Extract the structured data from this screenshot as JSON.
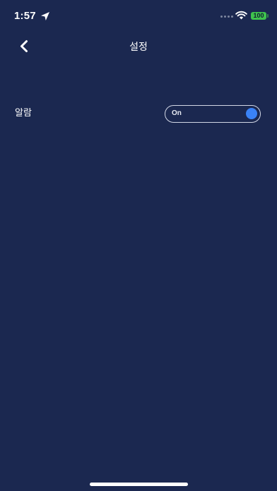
{
  "status_bar": {
    "time": "1:57",
    "battery": "100",
    "icons": [
      "location-arrow-icon",
      "cellular-signal-icon",
      "wifi-icon",
      "battery-icon"
    ]
  },
  "nav": {
    "title": "설정",
    "back_icon": "chevron-left-icon"
  },
  "settings": {
    "alarm": {
      "label": "알람",
      "toggle_text": "On",
      "enabled": true
    }
  },
  "colors": {
    "background": "#1b2850",
    "text": "#ffffff",
    "toggle_border": "#d3d8e6",
    "toggle_knob": "#3a82f6",
    "battery": "#3fc24d"
  }
}
